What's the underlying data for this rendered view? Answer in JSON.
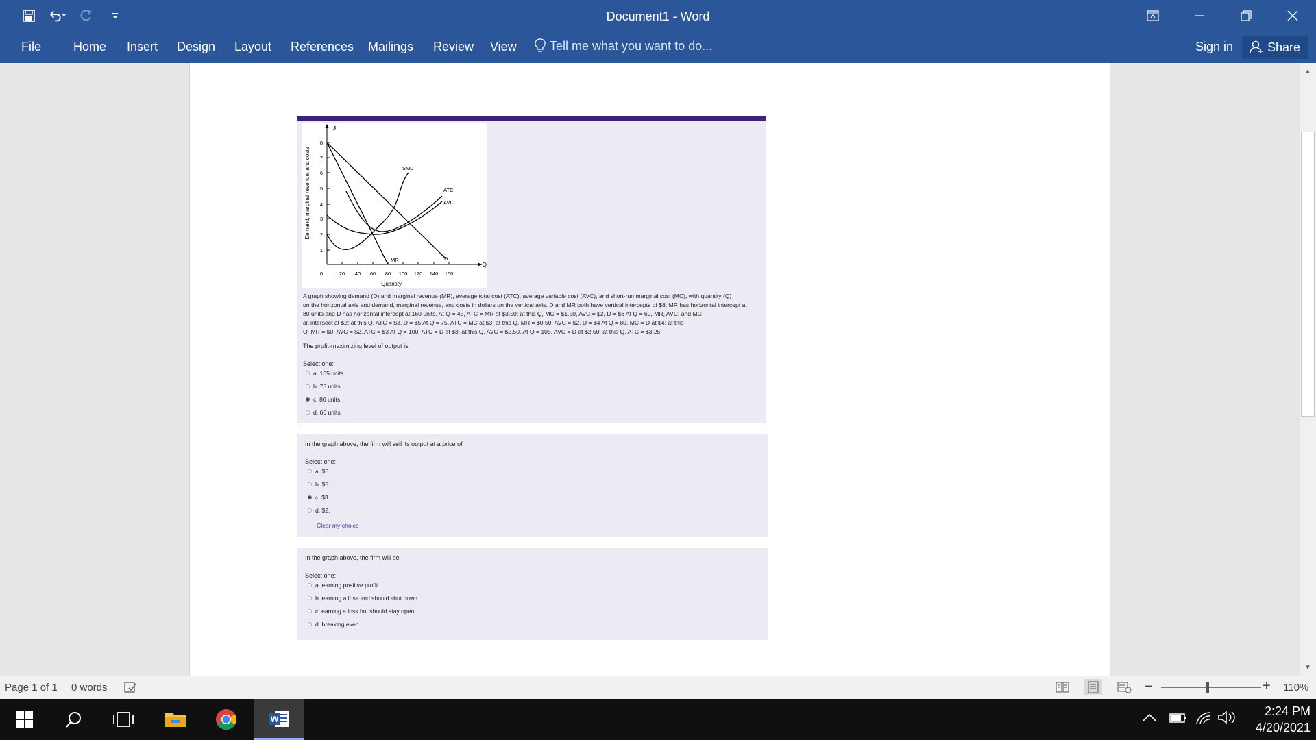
{
  "window": {
    "title": "Document1 - Word"
  },
  "qat": {
    "save_icon": "save-icon",
    "undo_icon": "undo-icon",
    "redo_icon": "redo-icon",
    "customize_icon": "customize-qat-icon"
  },
  "ribbon": {
    "tabs": [
      "File",
      "Home",
      "Insert",
      "Design",
      "Layout",
      "References",
      "Mailings",
      "Review",
      "View"
    ],
    "tell_me": "Tell me what you want to do...",
    "sign_in": "Sign in",
    "share": "Share"
  },
  "question1": {
    "graph": {
      "y_symbol": "$",
      "y_label": "Demand, marginal revenue, and costs",
      "y_ticks": [
        "8",
        "7",
        "6",
        "5",
        "4",
        "3",
        "2",
        "1",
        "0"
      ],
      "x_ticks": [
        "20",
        "40",
        "60",
        "80",
        "100",
        "120",
        "140",
        "160"
      ],
      "x_symbol": "Q",
      "x_label": "Quantity",
      "curve_labels": {
        "smc": "SMC",
        "atc": "ATC",
        "avc": "AVC",
        "d": "D",
        "mr": "MR"
      }
    },
    "description": [
      "A graph showing demand (D) and marginal revenue (MR), average total cost (ATC), average variable cost (AVC), and short-run marginal cost (MC), with quantity (Q)",
      "on the horizontal axis and demand, marginal revenue, and costs in dollars on the vertical axis. D and MR both have vertical intercepts of $8; MR has horizontal intercept at",
      "80 units and D has horizontal intercept at 160 units. At Q = 45, ATC = MR at $3.50; at this Q, MC = $1.50, AVC = $2, D = $6 At Q = 60, MR, AVC, and MC",
      "all intersect at $2; at this Q, ATC = $3, D = $5 At Q = 75, ATC = MC at $3; at this Q, MR = $0.50, AVC = $2, D = $4 At Q = 80, MC = D at $4; at this",
      "Q, MR = $0, AVC = $2, ATC = $3 At Q = 100, ATC = D at $3; at this Q, AVC = $2.50. At Q = 105, AVC = D at $2.50; at this Q, ATC = $3.25"
    ],
    "text": "The profit-maximizing level of output is",
    "select_one": "Select one:",
    "options": [
      "a. 105 units.",
      "b. 75 units.",
      "c. 80 units.",
      "d. 60 units."
    ],
    "selected_index": 2
  },
  "question2": {
    "text": "In the graph above, the firm will sell its output at a price of",
    "select_one": "Select one:",
    "options": [
      "a. $6.",
      "b. $5.",
      "c. $3.",
      "d. $2."
    ],
    "selected_index": 2,
    "clear": "Clear my choice"
  },
  "question3": {
    "text": "In the graph above, the firm will be",
    "select_one": "Select one:",
    "options": [
      "a. earning positive profit.",
      "b. earning a loss and should shut down.",
      "c. earning a loss but should stay open.",
      "d. breaking even."
    ],
    "selected_index": -1
  },
  "statusbar": {
    "page": "Page 1 of 1",
    "words": "0 words",
    "zoom": "110%"
  },
  "taskbar": {
    "time": "2:24 PM",
    "date": "4/20/2021"
  }
}
